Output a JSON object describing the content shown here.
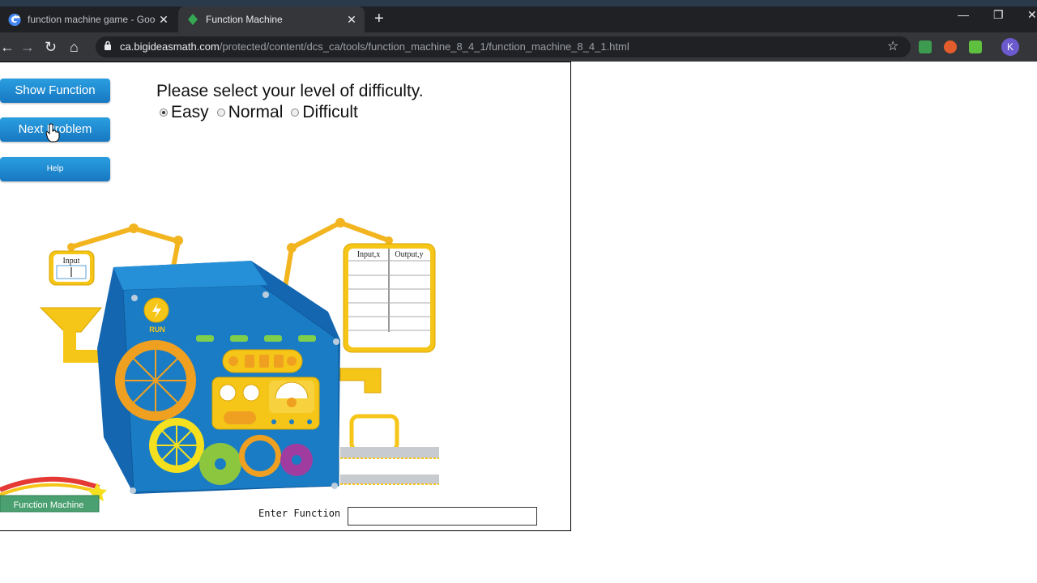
{
  "browser": {
    "tabs": [
      {
        "title": "function machine game - Google",
        "active": false
      },
      {
        "title": "Function Machine",
        "active": true
      }
    ],
    "new_tab": "+",
    "url_host": "ca.bigideasmath.com",
    "url_path": "/protected/content/dcs_ca/tools/function_machine_8_4_1/function_machine_8_4_1.html",
    "profile_initial": "K"
  },
  "sidebar": {
    "show_function": "Show Function",
    "next_problem": "Next Problem",
    "help": "Help"
  },
  "difficulty": {
    "prompt": "Please select your level of difficulty.",
    "options": [
      {
        "label": "Easy",
        "selected": true
      },
      {
        "label": "Normal",
        "selected": false
      },
      {
        "label": "Difficult",
        "selected": false
      }
    ]
  },
  "machine": {
    "input_label": "Input",
    "run_label": "RUN",
    "table_headers": [
      "Input,x",
      "Output,y"
    ],
    "logo_text": "Function Machine"
  },
  "enter_function": {
    "label": "Enter Function",
    "value": ""
  },
  "colors": {
    "machine_blue": "#1a7cc4",
    "gear_orange": "#f0a020",
    "button_blue": "#1e8fd6",
    "frame_yellow": "#f5c518"
  }
}
